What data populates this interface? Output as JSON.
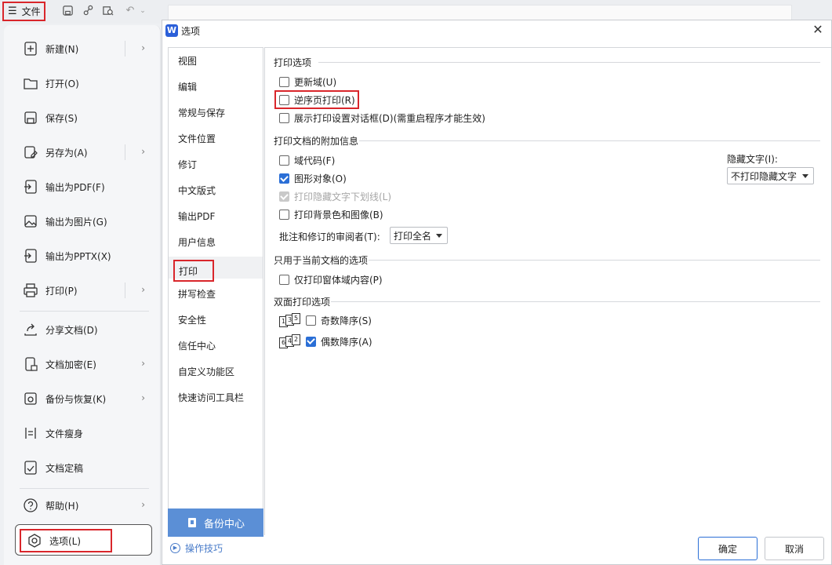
{
  "toolbar": {
    "file_label": "文件",
    "icons": [
      "save-icon",
      "share-icon",
      "search-doc-icon",
      "undo-icon"
    ]
  },
  "file_menu": {
    "items": [
      {
        "label": "新建(N)",
        "icon": "new-doc-icon",
        "arrow": true
      },
      {
        "label": "打开(O)",
        "icon": "folder-open-icon",
        "arrow": false
      },
      {
        "label": "保存(S)",
        "icon": "save-icon",
        "arrow": false
      },
      {
        "label": "另存为(A)",
        "icon": "save-as-icon",
        "arrow": true
      },
      {
        "label": "输出为PDF(F)",
        "icon": "export-pdf-icon",
        "arrow": false
      },
      {
        "label": "输出为图片(G)",
        "icon": "export-image-icon",
        "arrow": false
      },
      {
        "label": "输出为PPTX(X)",
        "icon": "export-pptx-icon",
        "arrow": false
      },
      {
        "label": "打印(P)",
        "icon": "print-icon",
        "arrow": true
      },
      {
        "label": "分享文档(D)",
        "icon": "share-icon",
        "arrow": false
      },
      {
        "label": "文档加密(E)",
        "icon": "encrypt-icon",
        "arrow": true
      },
      {
        "label": "备份与恢复(K)",
        "icon": "backup-icon",
        "arrow": true
      },
      {
        "label": "文件瘦身",
        "icon": "slim-icon",
        "arrow": false
      },
      {
        "label": "文档定稿",
        "icon": "finalize-icon",
        "arrow": false
      },
      {
        "label": "帮助(H)",
        "icon": "help-icon",
        "arrow": true
      }
    ],
    "options_label": "选项(L)"
  },
  "dialog": {
    "title": "选项",
    "logo": "W",
    "nav": [
      "视图",
      "编辑",
      "常规与保存",
      "文件位置",
      "修订",
      "中文版式",
      "输出PDF",
      "用户信息",
      "打印",
      "拼写检查",
      "安全性",
      "信任中心",
      "自定义功能区",
      "快速访问工具栏"
    ],
    "active_nav": "打印",
    "backup_label": "备份中心",
    "tips_label": "操作技巧",
    "ok_label": "确定",
    "cancel_label": "取消",
    "sections": {
      "print_options": {
        "title": "打印选项",
        "items": [
          {
            "label": "更新域(U)",
            "checked": false
          },
          {
            "label": "逆序页打印(R)",
            "checked": false
          },
          {
            "label": "展示打印设置对话框(D)(需重启程序才能生效)",
            "checked": false
          }
        ]
      },
      "extra_info": {
        "title": "打印文档的附加信息",
        "items": [
          {
            "label": "域代码(F)",
            "checked": false
          },
          {
            "label": "图形对象(O)",
            "checked": true
          },
          {
            "label": "打印隐藏文字下划线(L)",
            "checked": true,
            "disabled": true
          },
          {
            "label": "打印背景色和图像(B)",
            "checked": false
          }
        ],
        "hidden_text_label": "隐藏文字(I):",
        "hidden_text_value": "不打印隐藏文字",
        "reviewer_label": "批注和修订的审阅者(T):",
        "reviewer_value": "打印全名"
      },
      "current_doc": {
        "title": "只用于当前文档的选项",
        "items": [
          {
            "label": "仅打印窗体域内容(P)",
            "checked": false
          }
        ]
      },
      "duplex": {
        "title": "双面打印选项",
        "items": [
          {
            "label": "奇数降序(S)",
            "checked": false,
            "pages": [
              "1",
              "3",
              "5"
            ]
          },
          {
            "label": "偶数降序(A)",
            "checked": true,
            "pages": [
              "6",
              "4",
              "2"
            ]
          }
        ]
      }
    }
  }
}
